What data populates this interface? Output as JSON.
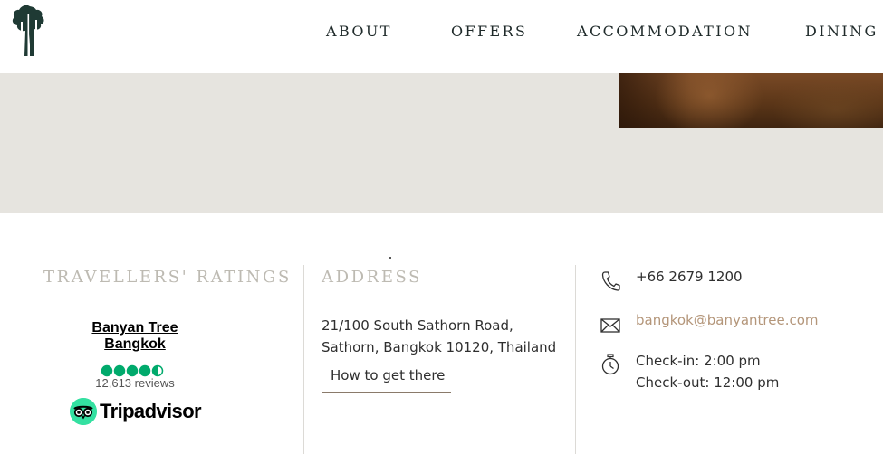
{
  "nav": {
    "items": [
      "ABOUT",
      "OFFERS",
      "ACCOMMODATION",
      "DINING"
    ]
  },
  "ratings": {
    "title": "TRAVELLERS' RATINGS",
    "hotel_name": "Banyan Tree Bangkok",
    "rating": 4.5,
    "reviews": "12,613 reviews",
    "provider": "Tripadvisor"
  },
  "address": {
    "title": "ADDRESS",
    "line1": "21/100 South Sathorn Road,",
    "line2": "Sathorn, Bangkok 10120, Thailand",
    "directions_label": "How to get there"
  },
  "contact": {
    "phone": "+66 2679 1200",
    "email": "bangkok@banyantree.com",
    "checkin": "Check-in: 2:00 pm",
    "checkout": "Check-out: 12:00 pm"
  },
  "colors": {
    "brand_green": "#1f3a34",
    "band_grey": "#e6e4df",
    "title_grey": "#bdbab2",
    "email_link": "#b4967a",
    "tripadvisor_green": "#34e0a1",
    "rating_bubble": "#00aa6c"
  },
  "icons": [
    "banyan-tree-logo-icon",
    "phone-icon",
    "mail-icon",
    "stopwatch-icon",
    "tripadvisor-owl-icon"
  ]
}
